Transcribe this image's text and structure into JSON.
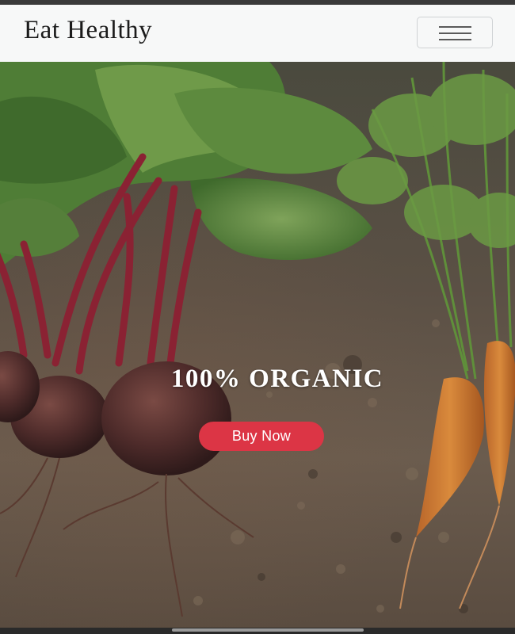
{
  "navbar": {
    "brand": "Eat Healthy",
    "toggler_icon": "hamburger-menu-icon"
  },
  "hero": {
    "title": "100% ORGANIC",
    "button_label": "Buy Now",
    "background": "beets-and-carrots-on-soil-photo"
  },
  "colors": {
    "navbar_bg": "#f7f8f8",
    "brand_text": "#1b1b1b",
    "button_bg": "#dc3545",
    "button_text": "#ffffff",
    "hero_text": "#ffffff"
  }
}
